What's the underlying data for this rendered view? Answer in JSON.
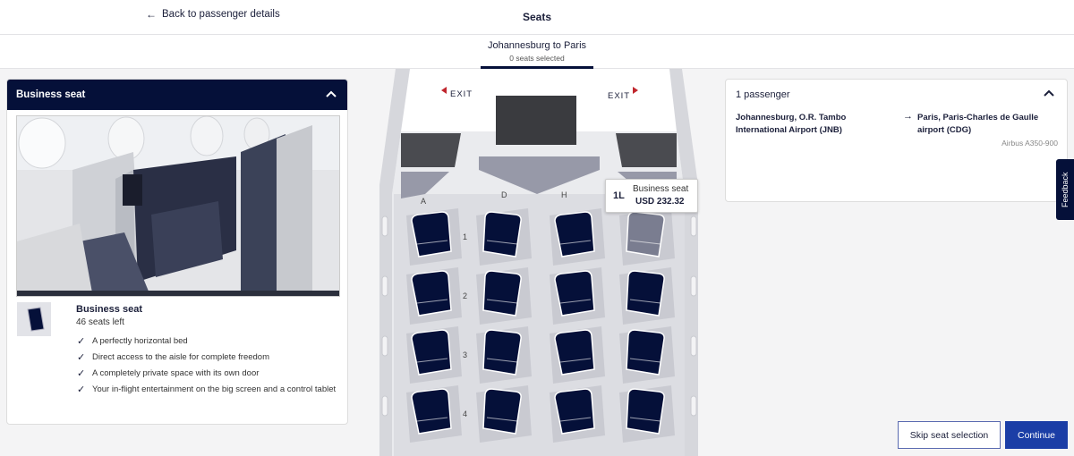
{
  "header": {
    "back_label": "Back to passenger details",
    "title": "Seats"
  },
  "tab": {
    "route": "Johannesburg to Paris",
    "selected": "0 seats selected"
  },
  "seat_panel": {
    "title": "Business seat",
    "seat_name": "Business seat",
    "seats_left": "46 seats left",
    "features": [
      "A perfectly horizontal bed",
      "Direct access to the aisle for complete freedom",
      "A completely private space with its own door",
      "Your in-flight entertainment on the big screen and a control tablet"
    ]
  },
  "seatmap": {
    "exit_left": "EXIT",
    "exit_right": "EXIT",
    "columns": [
      "A",
      "D",
      "H"
    ],
    "rows": [
      "1",
      "2",
      "3",
      "4"
    ],
    "tooltip": {
      "seat": "1L",
      "class": "Business seat",
      "price": "USD 232.32"
    },
    "colors": {
      "seat": "#051039",
      "seat_hover": "#7a7d90",
      "floor": "#dcdde2"
    }
  },
  "passenger": {
    "heading": "1 passenger",
    "from": "Johannesburg, O.R. Tambo International Airport (JNB)",
    "to": "Paris, Paris-Charles de Gaulle airport (CDG)",
    "aircraft": "Airbus A350-900"
  },
  "feedback_label": "Feedback",
  "actions": {
    "skip": "Skip seat selection",
    "continue": "Continue"
  }
}
